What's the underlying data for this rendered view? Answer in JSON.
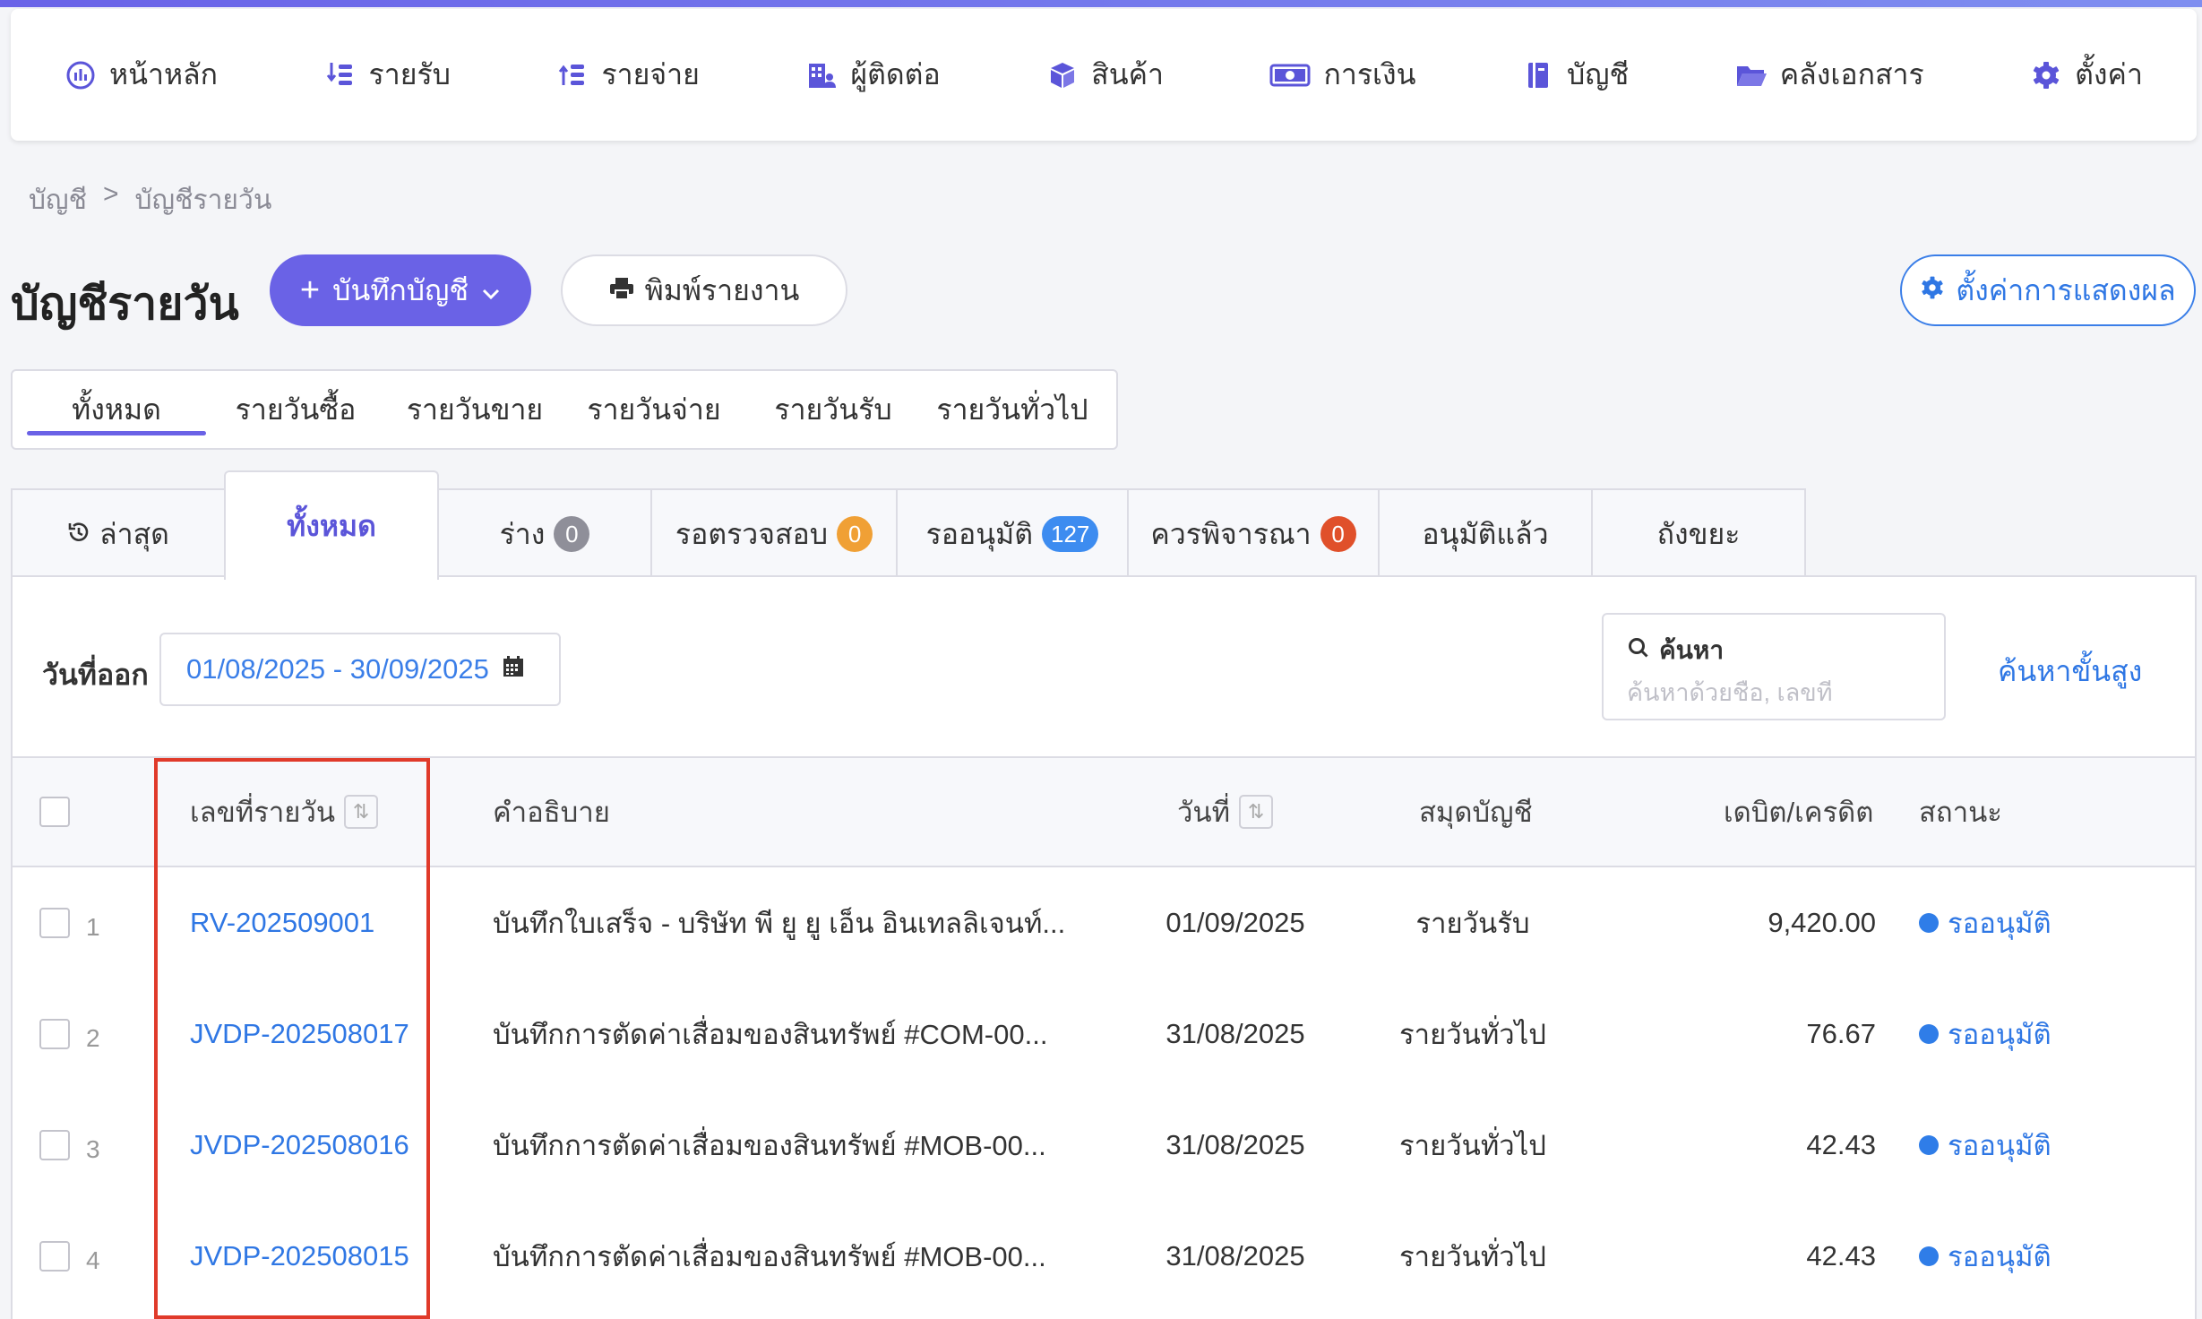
{
  "nav": {
    "items": [
      {
        "label": "หน้าหลัก",
        "icon": "dashboard-icon"
      },
      {
        "label": "รายรับ",
        "icon": "income-icon"
      },
      {
        "label": "รายจ่าย",
        "icon": "expense-icon"
      },
      {
        "label": "ผู้ติดต่อ",
        "icon": "contacts-icon"
      },
      {
        "label": "สินค้า",
        "icon": "box-icon"
      },
      {
        "label": "การเงิน",
        "icon": "money-icon"
      },
      {
        "label": "บัญชี",
        "icon": "ledger-icon"
      },
      {
        "label": "คลังเอกสาร",
        "icon": "folder-icon"
      },
      {
        "label": "ตั้งค่า",
        "icon": "gear-icon"
      }
    ]
  },
  "breadcrumb": {
    "parent": "บัญชี",
    "separator": ">",
    "current": "บัญชีรายวัน"
  },
  "page": {
    "title": "บัญชีรายวัน",
    "record_button": "บันทึกบัญชี",
    "print_button": "พิมพ์รายงาน",
    "settings_button": "ตั้งค่าการแสดงผล"
  },
  "type_tabs": [
    "ทั้งหมด",
    "รายวันซื้อ",
    "รายวันขาย",
    "รายวันจ่าย",
    "รายวันรับ",
    "รายวันทั่วไป"
  ],
  "status_tabs": {
    "latest": "ล่าสุด",
    "all": "ทั้งหมด",
    "draft": {
      "label": "ร่าง",
      "count": "0"
    },
    "review": {
      "label": "รอตรวจสอบ",
      "count": "0"
    },
    "approve": {
      "label": "รออนุมัติ",
      "count": "127"
    },
    "consider": {
      "label": "ควรพิจารณา",
      "count": "0"
    },
    "approved": "อนุมัติแล้ว",
    "trash": "ถังขยะ"
  },
  "filters": {
    "date_label": "วันที่ออก",
    "date_range": "01/08/2025 - 30/09/2025",
    "search_label": "ค้นหา",
    "search_placeholder": "ค้นหาด้วยชื่อ, เลขที่",
    "advanced_link": "ค้นหาขั้นสูง"
  },
  "table": {
    "headers": {
      "number": "เลขที่รายวัน",
      "description": "คำอธิบาย",
      "date": "วันที่",
      "book": "สมุดบัญชี",
      "amount": "เดบิต/เครดิต",
      "status": "สถานะ"
    },
    "rows": [
      {
        "index": "1",
        "number": "RV-202509001",
        "description": "บันทึกใบเสร็จ - บริษัท พี ยู ยู เอ็น อินเทลลิเจนท์...",
        "date": "01/09/2025",
        "book": "รายวันรับ",
        "amount": "9,420.00",
        "status": "รออนุมัติ"
      },
      {
        "index": "2",
        "number": "JVDP-202508017",
        "description": "บันทึกการตัดค่าเสื่อมของสินทรัพย์ #COM-00...",
        "date": "31/08/2025",
        "book": "รายวันทั่วไป",
        "amount": "76.67",
        "status": "รออนุมัติ"
      },
      {
        "index": "3",
        "number": "JVDP-202508016",
        "description": "บันทึกการตัดค่าเสื่อมของสินทรัพย์ #MOB-00...",
        "date": "31/08/2025",
        "book": "รายวันทั่วไป",
        "amount": "42.43",
        "status": "รออนุมัติ"
      },
      {
        "index": "4",
        "number": "JVDP-202508015",
        "description": "บันทึกการตัดค่าเสื่อมของสินทรัพย์ #MOB-00...",
        "date": "31/08/2025",
        "book": "รายวันทั่วไป",
        "amount": "42.43",
        "status": "รออนุมัติ"
      }
    ]
  },
  "colors": {
    "primary": "#6a62e6",
    "link": "#2f77e4",
    "badge_gray": "#8f8f99",
    "badge_orange": "#f0a035",
    "badge_blue": "#3d8cf0",
    "badge_red": "#e0502a",
    "highlight": "#e03a2a"
  }
}
